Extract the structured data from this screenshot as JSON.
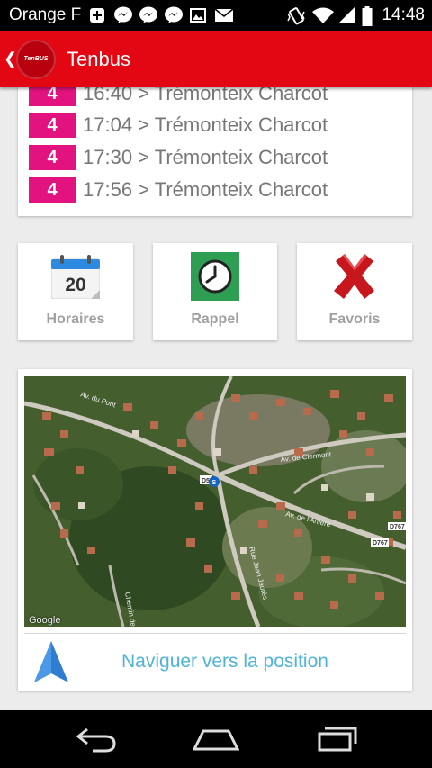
{
  "status_bar": {
    "carrier": "Orange F",
    "time": "14:48",
    "left_icons": [
      "plus-square-icon",
      "messenger-icon",
      "messenger-icon",
      "messenger-icon",
      "image-icon",
      "mail-icon"
    ],
    "right_icons": [
      "vibrate-icon",
      "wifi-icon",
      "signal-icon",
      "battery-icon"
    ]
  },
  "app_bar": {
    "logo_text": "TenBUS",
    "title": "Tenbus"
  },
  "departures": [
    {
      "line": "4",
      "text": "16:40 > Trémonteix Charcot"
    },
    {
      "line": "4",
      "text": "17:04 > Trémonteix Charcot"
    },
    {
      "line": "4",
      "text": "17:30 > Trémonteix Charcot"
    },
    {
      "line": "4",
      "text": "17:56 > Trémonteix Charcot"
    }
  ],
  "actions": {
    "horaires": {
      "label": "Horaires",
      "calendar_day": "20",
      "icon": "calendar-icon"
    },
    "rappel": {
      "label": "Rappel",
      "icon": "clock-icon"
    },
    "favoris": {
      "label": "Favoris",
      "icon": "cross-icon"
    }
  },
  "map": {
    "attribution": "Google",
    "street_labels": [
      "Av. du Pont",
      "Av. de Clermont",
      "Av. de l'Artière",
      "D767",
      "D767",
      "Chemin de",
      "Rue Jean Jaurès"
    ],
    "route_badges": [
      "D5",
      "S"
    ],
    "navigate_label": "Naviguer vers la position",
    "navigate_icon": "navigation-arrow-icon"
  },
  "nav_bar": {
    "buttons": [
      "back-icon",
      "home-icon",
      "recents-icon"
    ]
  },
  "colors": {
    "brand_red": "#e30613",
    "line_badge": "#e2137f",
    "link_blue": "#4fb3d9",
    "nav_arrow": "#2f7dd1"
  }
}
